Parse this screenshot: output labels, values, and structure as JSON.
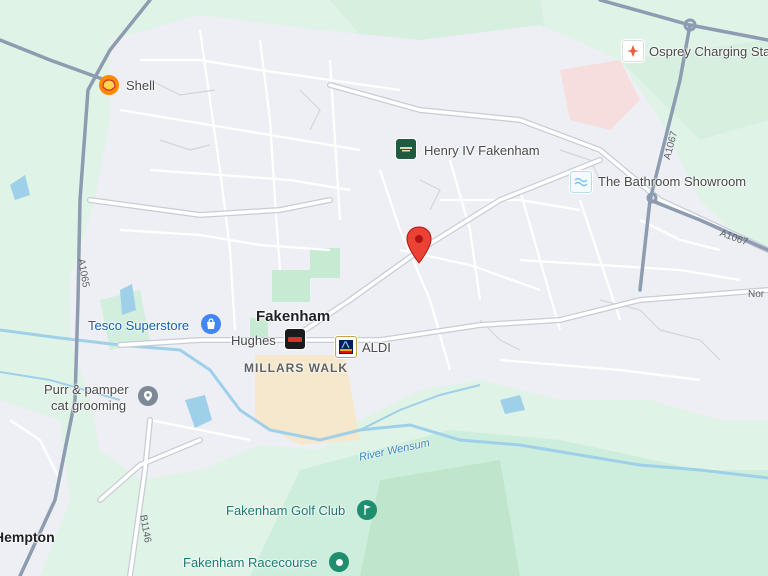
{
  "map": {
    "colors": {
      "town_fill": "#eeeff4",
      "green": "#cdeedd",
      "green_dark": "#b8e4c8",
      "road": "#ffffff",
      "road_casing": "#c8cbd3",
      "major_road": "#8d9cb0",
      "water": "#9fd0ea",
      "commercial": "#f5e8cc",
      "marker_red": "#ea4335"
    },
    "towns": {
      "fakenham": "Fakenham",
      "hempton": "Hempton"
    },
    "areas": {
      "millars_walk": "MILLARS WALK"
    },
    "pois": {
      "shell": {
        "label": "Shell",
        "icon": "shell-fuel-icon"
      },
      "osprey": {
        "label": "Osprey Charging Sta",
        "icon": "ev-charging-icon"
      },
      "henry": {
        "label": "Henry IV Fakenham",
        "icon": "pub-icon"
      },
      "bathroom": {
        "label": "The Bathroom Showroom",
        "icon": "store-icon"
      },
      "tesco": {
        "label": "Tesco Superstore",
        "icon": "shopping-bag-icon"
      },
      "hughes": {
        "label": "Hughes",
        "icon": "hughes-store-icon"
      },
      "aldi": {
        "label": "ALDI",
        "icon": "aldi-logo-icon"
      },
      "purr_line1": "Purr & pamper",
      "purr_line2": "cat grooming",
      "purr_icon": "pin-icon",
      "golf": {
        "label": "Fakenham Golf Club",
        "icon": "golf-icon"
      },
      "racecourse": {
        "label": "Fakenham Racecourse",
        "icon": "place-icon"
      }
    },
    "roads": {
      "a1065": "A1065",
      "a1067_north": "A1067",
      "a1067_east": "A1067",
      "b1146": "B1146",
      "east_road": "Nor"
    },
    "river": "River Wensum",
    "marker": "red-location-pin-icon"
  }
}
